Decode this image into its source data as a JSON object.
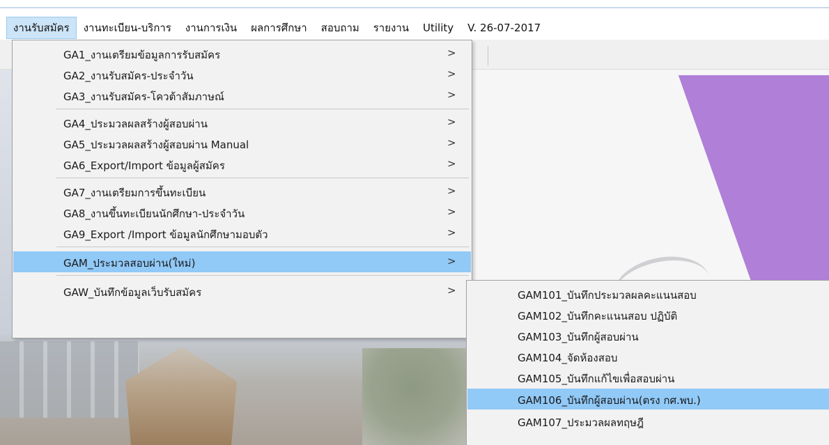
{
  "menubar": {
    "items": [
      {
        "label": "งานรับสมัคร",
        "active": true
      },
      {
        "label": "งานทะเบียน-บริการ"
      },
      {
        "label": "งานการเงิน"
      },
      {
        "label": "ผลการศึกษา"
      },
      {
        "label": "สอบถาม"
      },
      {
        "label": "รายงาน"
      },
      {
        "label": "Utility"
      },
      {
        "label": "V. 26-07-2017"
      }
    ]
  },
  "dropdown": {
    "items": [
      {
        "label": "GA1_งานเตรียมข้อมูลการรับสมัคร",
        "arrow": ">"
      },
      {
        "label": "GA2_งานรับสมัคร-ประจำวัน",
        "arrow": ">"
      },
      {
        "label": "GA3_งานรับสมัคร-โควต้าสัมภาษณ์",
        "arrow": ">"
      },
      {
        "label": "GA4_ประมวลผลสร้างผู้สอบผ่าน",
        "arrow": ">"
      },
      {
        "label": "GA5_ประมวลผลสร้างผู้สอบผ่าน Manual",
        "arrow": ">"
      },
      {
        "label": "GA6_Export/Import ข้อมูลผู้สมัคร",
        "arrow": ">"
      },
      {
        "label": "GA7_งานเตรียมการขึ้นทะเบียน",
        "arrow": ">"
      },
      {
        "label": "GA8_งานขึ้นทะเบียนนักศึกษา-ประจำวัน",
        "arrow": ">"
      },
      {
        "label": "GA9_Export /Import ข้อมูลนักศึกษามอบตัว",
        "arrow": ">"
      },
      {
        "label": "GAM_ประมวลสอบผ่าน(ใหม่)",
        "arrow": ">",
        "highlighted": true
      },
      {
        "label": "GAW_บันทึกข้อมูลเว็บรับสมัคร",
        "arrow": ">"
      }
    ]
  },
  "submenu": {
    "items": [
      {
        "label": "GAM101_บันทึกประมวลผลคะแนนสอบ"
      },
      {
        "label": "GAM102_บันทึกคะแนนสอบ ปฏิบัติ"
      },
      {
        "label": "GAM103_บันทึกผู้สอบผ่าน"
      },
      {
        "label": "GAM104_จัดห้องสอบ"
      },
      {
        "label": "GAM105_บันทึกแก้ไขเพื่อสอบผ่าน"
      },
      {
        "label": "GAM106_บันทึกผู้สอบผ่าน(ตรง กศ.พบ.)",
        "highlighted": true
      },
      {
        "label": "GAM107_ประมวลผลทฤษฎี"
      }
    ]
  },
  "colors": {
    "highlight": "#91c9f7",
    "menubar_active": "#cce4f7",
    "menu_background": "#f2f2f2",
    "background_purple": "#b07fd8"
  }
}
